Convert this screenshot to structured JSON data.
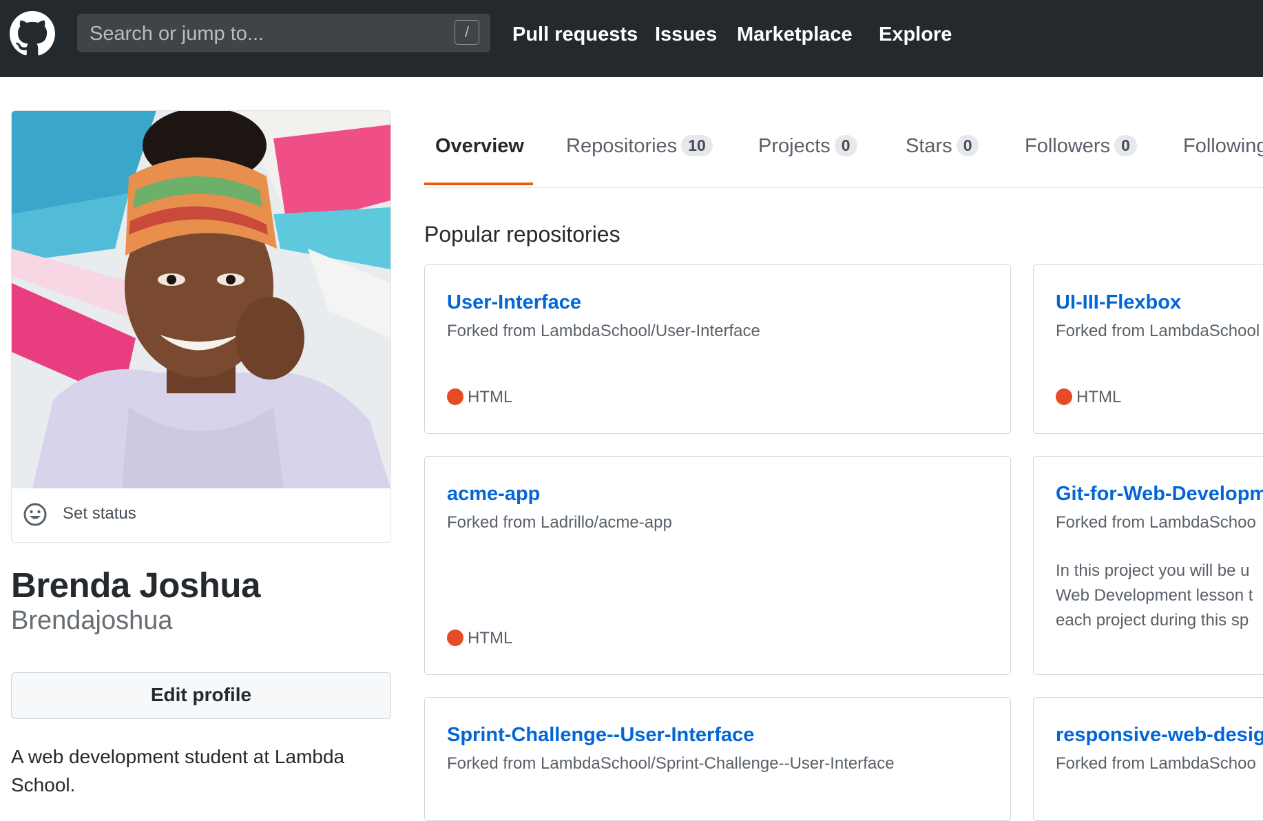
{
  "header": {
    "logo": "github-mark-icon",
    "search_placeholder": "Search or jump to...",
    "search_shortcut": "/",
    "nav": [
      "Pull requests",
      "Issues",
      "Marketplace",
      "Explore"
    ]
  },
  "profile": {
    "status_label": "Set status",
    "name": "Brenda Joshua",
    "username": "Brendajoshua",
    "edit_label": "Edit profile",
    "bio": "A web development student at Lambda School."
  },
  "tabs": [
    {
      "label": "Overview"
    },
    {
      "label": "Repositories",
      "count": "10"
    },
    {
      "label": "Projects",
      "count": "0"
    },
    {
      "label": "Stars",
      "count": "0"
    },
    {
      "label": "Followers",
      "count": "0"
    },
    {
      "label": "Following"
    }
  ],
  "section_title": "Popular repositories",
  "repos": [
    {
      "name": "User-Interface",
      "forked": "Forked from LambdaSchool/User-Interface",
      "language": "HTML"
    },
    {
      "name": "UI-III-Flexbox",
      "forked": "Forked from LambdaSchool",
      "language": "HTML"
    },
    {
      "name": "acme-app",
      "forked": "Forked from Ladrillo/acme-app",
      "language": "HTML"
    },
    {
      "name": "Git-for-Web-Developm",
      "forked": "Forked from LambdaSchoo",
      "description": "In this project you will be u Web Development lesson t each project during this sp"
    },
    {
      "name": "Sprint-Challenge--User-Interface",
      "forked": "Forked from LambdaSchool/Sprint-Challenge--User-Interface"
    },
    {
      "name": "responsive-web-desig",
      "forked": "Forked from LambdaSchoo"
    }
  ],
  "colors": {
    "header_bg": "#24292e",
    "link": "#0366d6",
    "tab_accent": "#e36209",
    "html_language": "#e34c26"
  }
}
